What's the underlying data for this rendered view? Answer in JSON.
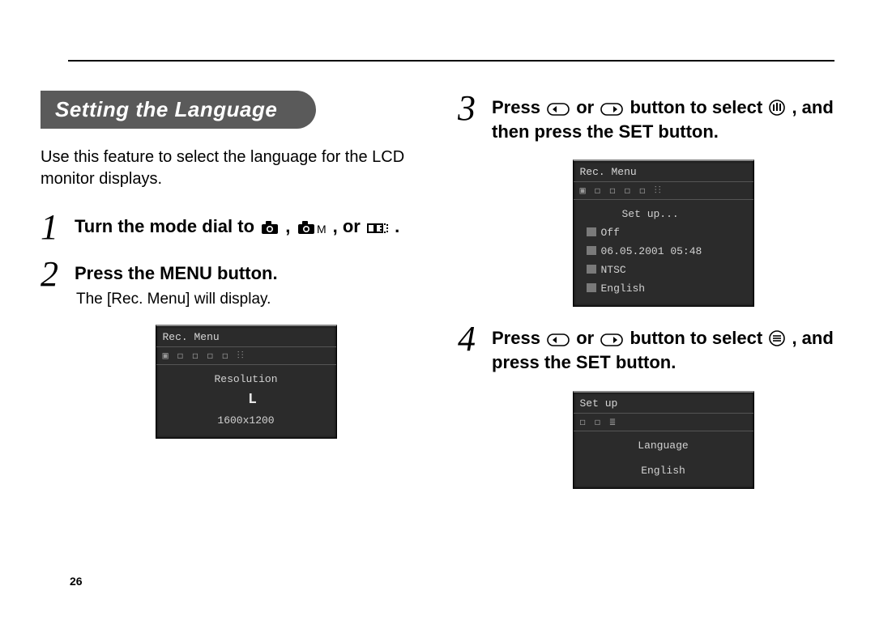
{
  "page_number": "26",
  "heading": "Setting the Language",
  "intro": "Use this feature to select the language for the LCD monitor displays.",
  "steps": {
    "s1": {
      "num": "1",
      "pre": "Turn the mode dial to ",
      "mid1": ", ",
      "mid2": ", or ",
      "post": "."
    },
    "s2": {
      "num": "2",
      "text": "Press the MENU button.",
      "note": "The [Rec. Menu] will display."
    },
    "s3": {
      "num": "3",
      "pre": "Press ",
      "mid1": " or ",
      "mid2": " button to select ",
      "post": ", and then press the SET button."
    },
    "s4": {
      "num": "4",
      "pre": "Press ",
      "mid1": " or ",
      "mid2": " button to select ",
      "post": ", and press the SET button."
    }
  },
  "lcd1": {
    "title": "Rec. Menu",
    "tabs_placeholder": "▣ ◻ ◻ ◻ ◻ ⫶⫶",
    "label": "Resolution",
    "value_big": "L",
    "value_sub": "1600x1200"
  },
  "lcd2": {
    "title": "Rec. Menu",
    "tabs_placeholder": "▣ ◻ ◻ ◻ ◻ ⫶⫶",
    "heading": "Set up...",
    "rows": {
      "r1": "Off",
      "r2": "06.05.2001 05:48",
      "r3": "NTSC",
      "r4": "English"
    }
  },
  "lcd3": {
    "title": "Set up",
    "tabs_placeholder": "◻ ◻ ≣",
    "label": "Language",
    "value": "English"
  }
}
